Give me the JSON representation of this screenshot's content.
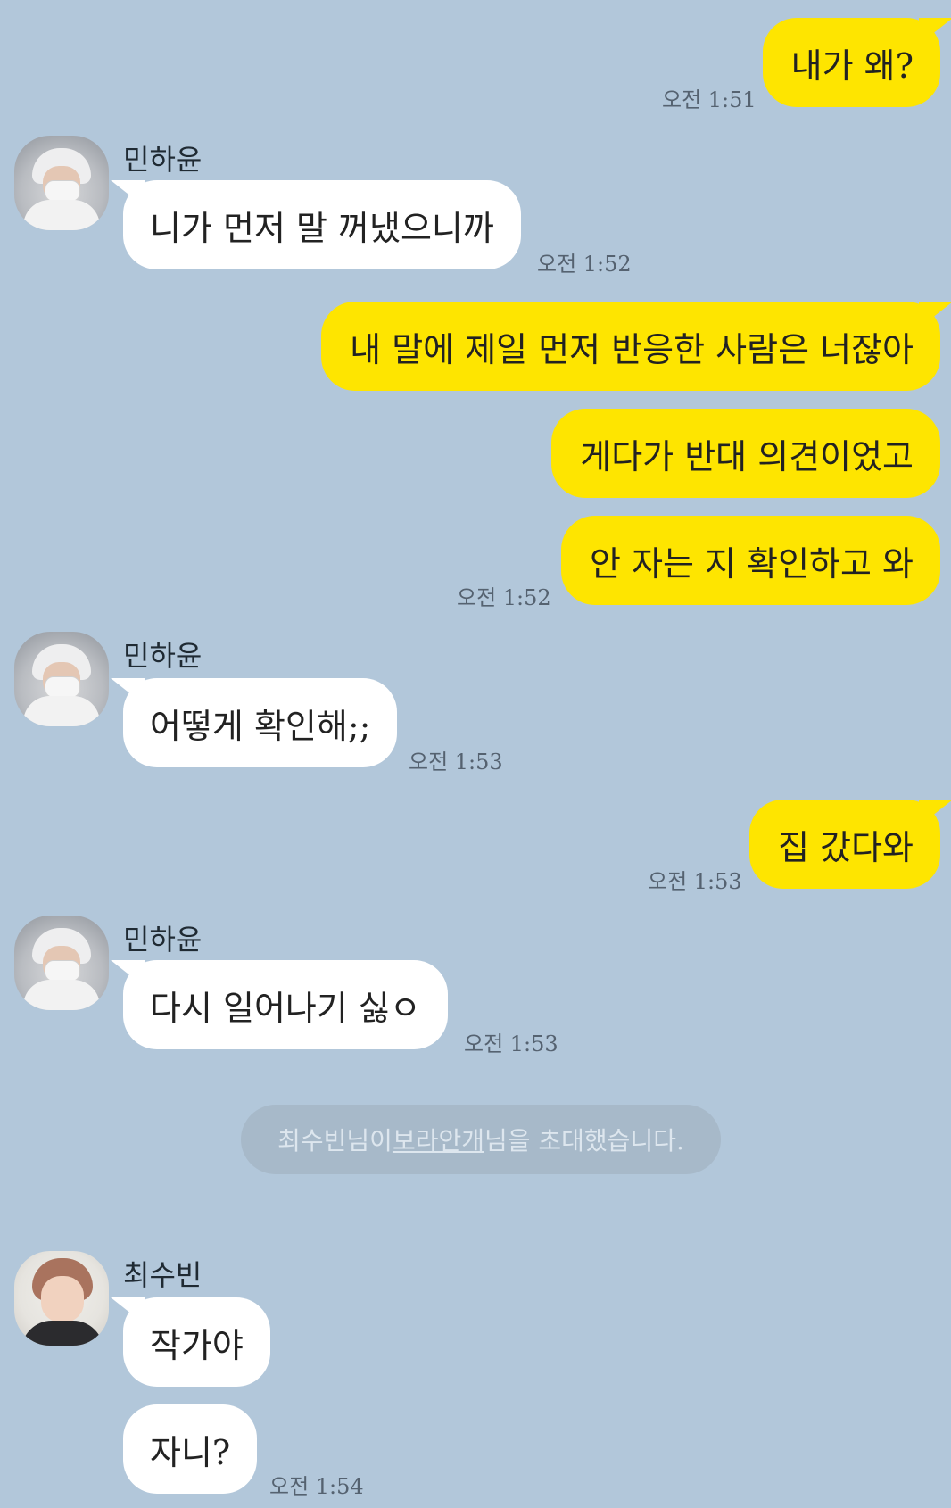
{
  "messages": {
    "m1": "내가 왜?",
    "m2": "니가 먼저 말 꺼냈으니까",
    "m3": "내 말에 제일 먼저 반응한 사람은 너잖아",
    "m4": "게다가 반대 의견이었고",
    "m5": "안 자는 지 확인하고 와",
    "m6": "어떻게 확인해;;",
    "m7": "집 갔다와",
    "m8": "다시 일어나기 싫ㅇ",
    "m9": "작가야",
    "m10": "자니?"
  },
  "times": {
    "t1": "오전 1:51",
    "t2": "오전 1:52",
    "t3": "오전 1:52",
    "t4": "오전 1:53",
    "t5": "오전 1:53",
    "t6": "오전 1:53",
    "t7": "오전 1:54"
  },
  "senders": {
    "s1": "민하윤",
    "s2": "민하윤",
    "s3": "민하윤",
    "s4": "최수빈"
  },
  "system_notice": {
    "part1": "최수빈님이 ",
    "link": "보라안개",
    "part2": "님을 초대했습니다."
  },
  "colors": {
    "background": "#b2c7da",
    "my_bubble": "#fee500",
    "their_bubble": "#ffffff"
  }
}
